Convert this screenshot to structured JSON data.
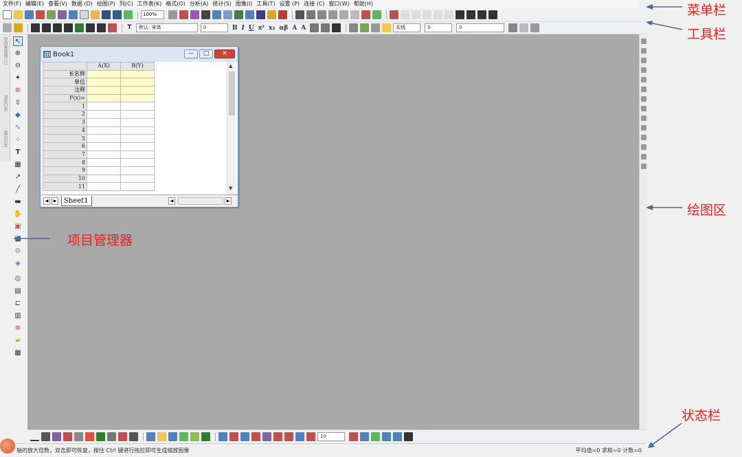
{
  "menu": [
    "文件(F)",
    "编辑(E)",
    "查看(V)",
    "数据 (D)",
    "绘图(P)",
    "列(C)",
    "工作表(K)",
    "格式(O)",
    "分析(A)",
    "统计(S)",
    "图像(I)",
    "工具(T)",
    "设置 (P)",
    "连接 (C)",
    "窗口(W)",
    "帮助(H)"
  ],
  "toolbar": {
    "zoom": "100%",
    "font_name": "默认: 宋体",
    "font_size": "0",
    "line_style": "实线",
    "line_width": "0",
    "pattern_size": "0"
  },
  "book": {
    "title": "Book1",
    "columns": [
      "A(X)",
      "B(Y)"
    ],
    "row_labels": [
      "长名称",
      "单位",
      "注释",
      "F(x)="
    ],
    "rows": [
      "1",
      "2",
      "3",
      "4",
      "5",
      "6",
      "7",
      "8",
      "9",
      "10",
      "11"
    ],
    "sheet_tab": "Sheet1",
    "controls": {
      "minimize": "—",
      "restore": "□",
      "close": "✕"
    }
  },
  "bottom_toolbar": {
    "size_value": "10"
  },
  "status": {
    "text": "轴的放大倍数，双击即可恢复，按住 Ctrl 键进行拖拉即可生成缩放图像",
    "stats": "平均值=0 求和=0 计数=0"
  },
  "left_panel_labels": [
    "项目管理器 (1)",
    "消息日志",
    "提示日志"
  ],
  "annotations": {
    "menubar": "菜单栏",
    "toolbar": "工具栏",
    "plotarea": "绘图区",
    "project_manager": "项目管理器",
    "statusbar": "状态栏"
  },
  "colors": {
    "annotation": "#e8231f",
    "arrow": "#4a6b92",
    "plot_bg": "#a9a9a9",
    "cell_highlight": "#fefccc"
  }
}
